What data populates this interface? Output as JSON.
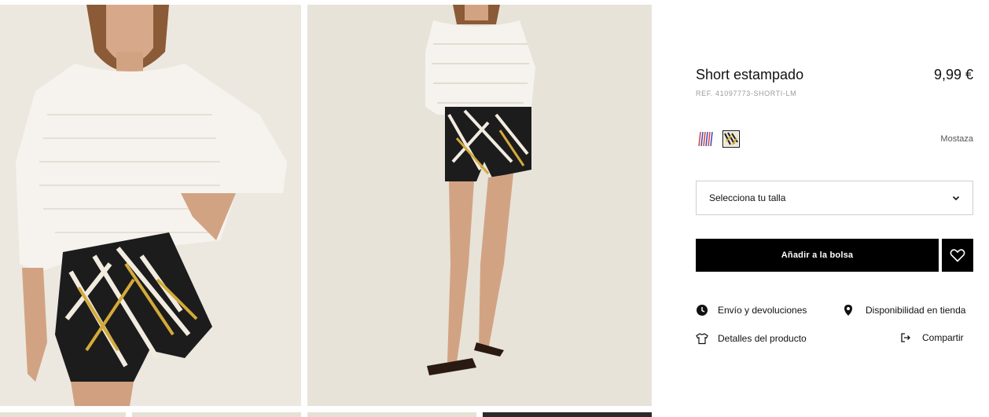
{
  "product": {
    "title": "Short estampado",
    "price": "9,99 €",
    "ref": "REF. 41097773-SHORTI-LM"
  },
  "colors": {
    "selected_name": "Mostaza",
    "swatches": [
      {
        "name": "multicolor-stripes",
        "selected": false
      },
      {
        "name": "mostaza-print",
        "selected": true
      }
    ]
  },
  "size": {
    "placeholder": "Selecciona tu talla"
  },
  "actions": {
    "add_to_bag": "Añadir a la bolsa"
  },
  "links": {
    "envio": "Envío y devoluciones",
    "disponibilidad": "Disponibilidad en tienda",
    "detalles": "Detalles del producto",
    "compartir": "Compartir"
  },
  "icons": {
    "envio": "clock-icon",
    "disponibilidad": "location-pin-icon",
    "detalles": "tshirt-icon",
    "compartir": "share-icon",
    "favorite": "heart-icon",
    "size": "chevron-down-icon"
  }
}
